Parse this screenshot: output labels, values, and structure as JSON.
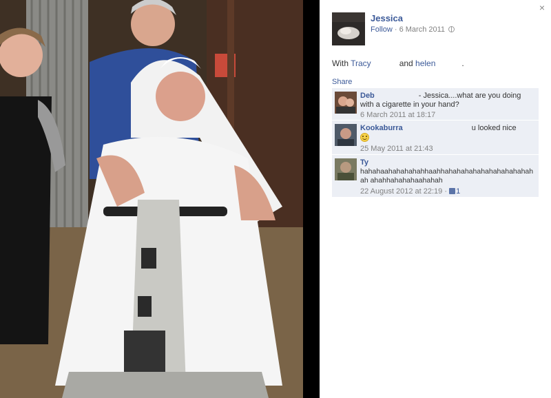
{
  "photo": {
    "alt_subject": "bride-on-mobility-scooter"
  },
  "viewer": {
    "close_label": "×"
  },
  "author": {
    "name": "Jessica",
    "follow_label": "Follow",
    "separator": " · ",
    "date": "6 March 2011"
  },
  "caption": {
    "prefix": "With ",
    "tag1": "Tracy",
    "joiner": "and ",
    "tag2": "helen",
    "suffix": "."
  },
  "share_label": "Share",
  "comments": [
    {
      "name": "Deb",
      "text": "Jessica....what are you doing with a cigarette in your hand?",
      "time": "6 March 2011 at 18:17"
    },
    {
      "name": "Kookaburra",
      "text": "u looked nice",
      "time": "25 May 2011 at 21:43"
    },
    {
      "name": "Ty",
      "text": "hahahaahahahahahhaahhahahahahahahahahahahahah ahahhahahahaahahah",
      "time": "22 August 2012 at 22:19",
      "separator": " · ",
      "likes": "1"
    }
  ],
  "colors": {
    "link": "#3b5998",
    "comment_bg": "#eceff5",
    "meta": "#808080"
  }
}
